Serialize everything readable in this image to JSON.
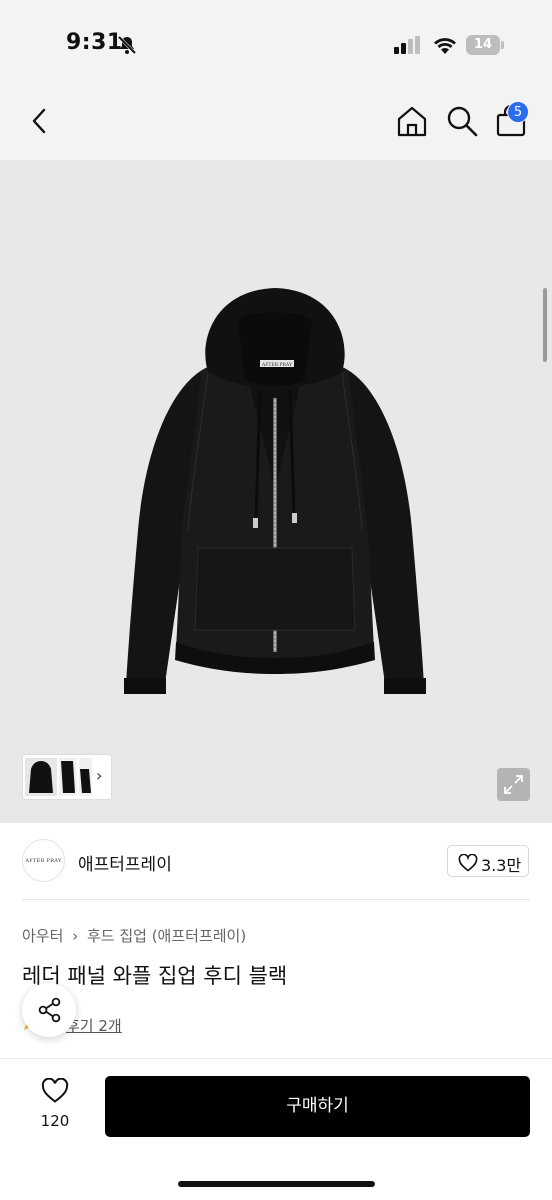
{
  "status_bar": {
    "time": "9:31",
    "battery": "14",
    "icons": [
      "bell-off-icon",
      "signal-icon",
      "wifi-icon",
      "battery-icon"
    ]
  },
  "nav": {
    "icons": [
      "back-icon",
      "home-icon",
      "search-icon",
      "bag-icon"
    ],
    "cart_badge": "5",
    "badge_color": "#2a6bf0"
  },
  "product_image": {
    "label_text": "AFTER PRAY",
    "thumbnail_next": "›"
  },
  "brand": {
    "logo_text": "AFTER PRAY",
    "name": "애프터프레이",
    "like_count": "3.3만"
  },
  "breadcrumb": {
    "items": [
      "아우터",
      "후드 집업 (애프터프레이)"
    ],
    "separator": "›"
  },
  "product": {
    "title": "레더 패널 와플 집업 후디 블랙",
    "review_text": "후기 2개"
  },
  "bottom_bar": {
    "wish_count": "120",
    "buy_label": "구매하기"
  },
  "colors": {
    "accent": "#2a6bf0",
    "buy_button": "#000000",
    "image_background": "#e8e8e8"
  }
}
